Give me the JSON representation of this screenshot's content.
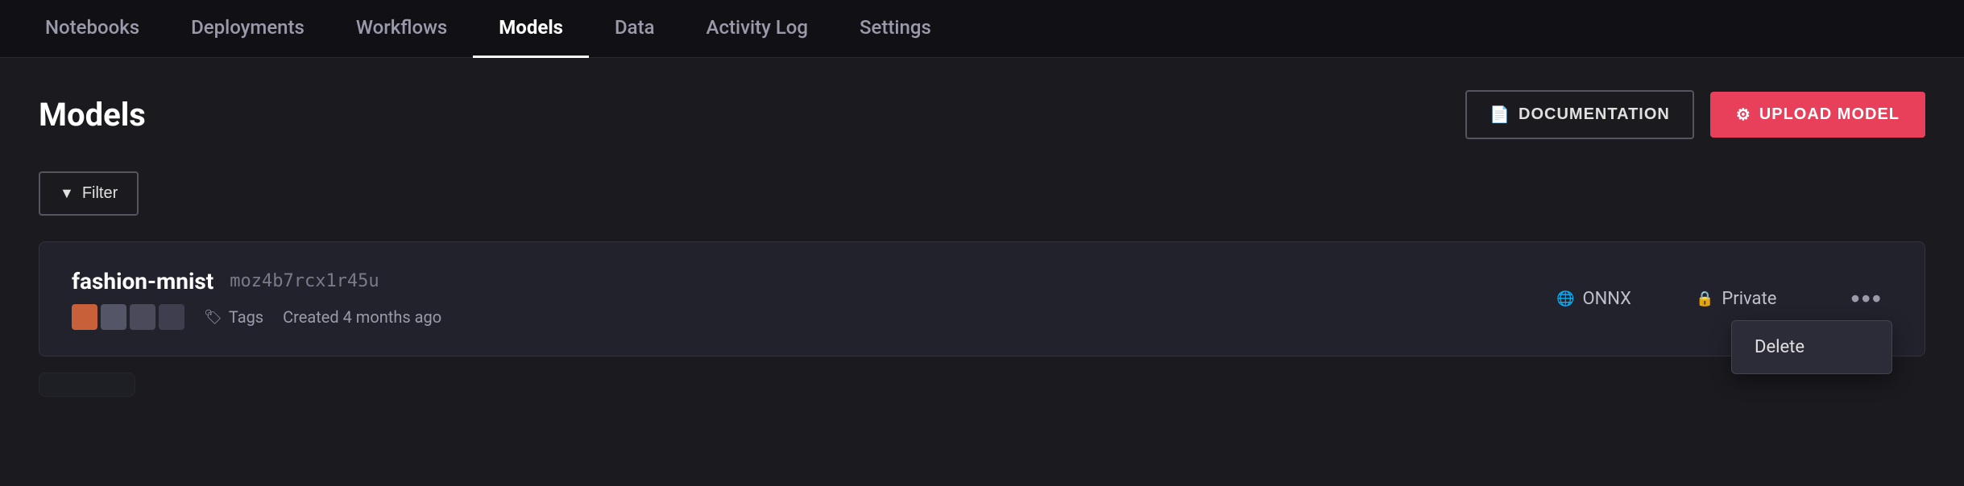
{
  "nav": {
    "tabs": [
      {
        "id": "notebooks",
        "label": "Notebooks",
        "active": false
      },
      {
        "id": "deployments",
        "label": "Deployments",
        "active": false
      },
      {
        "id": "workflows",
        "label": "Workflows",
        "active": false
      },
      {
        "id": "models",
        "label": "Models",
        "active": true
      },
      {
        "id": "data",
        "label": "Data",
        "active": false
      },
      {
        "id": "activity-log",
        "label": "Activity Log",
        "active": false
      },
      {
        "id": "settings",
        "label": "Settings",
        "active": false
      }
    ]
  },
  "header": {
    "title": "Models",
    "documentation_label": "DOCUMENTATION",
    "upload_label": "UPLOAD MODEL",
    "doc_icon": "📄",
    "upload_icon": "⚙"
  },
  "filter": {
    "label": "Filter",
    "icon": "▼"
  },
  "model": {
    "name": "fashion-mnist",
    "id": "moz4b7rcx1r45u",
    "format": "ONNX",
    "privacy": "Private",
    "created": "Created 4 months ago",
    "tags_label": "Tags",
    "more_icon": "•••",
    "globe_icon": "🌐",
    "lock_icon": "🔒",
    "tag_icon": "🏷"
  },
  "dropdown": {
    "items": [
      {
        "id": "delete",
        "label": "Delete"
      }
    ]
  }
}
